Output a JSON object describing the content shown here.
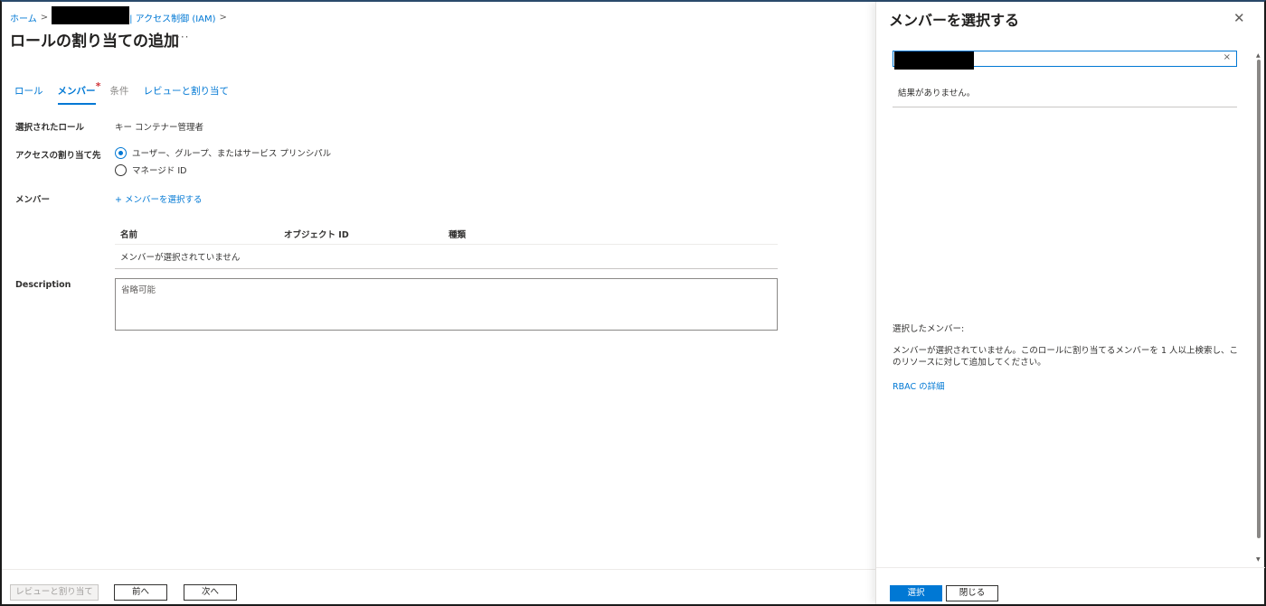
{
  "breadcrumb": {
    "home": "ホーム",
    "sep1": ">",
    "resource_tail": "| アクセス制御 (IAM)",
    "sep2": ">"
  },
  "page": {
    "title": "ロールの割り当ての追加",
    "more": "···"
  },
  "tabs": [
    {
      "label": "ロール",
      "state": "normal"
    },
    {
      "label": "メンバー",
      "state": "active",
      "required_mark": "*"
    },
    {
      "label": "条件",
      "state": "disabled"
    },
    {
      "label": "レビューと割り当て",
      "state": "normal"
    }
  ],
  "form": {
    "selected_role_label": "選択されたロール",
    "selected_role_value": "キー コンテナー管理者",
    "assign_to_label": "アクセスの割り当て先",
    "assign_options": [
      {
        "label": "ユーザー、グループ、またはサービス プリンシパル",
        "checked": true
      },
      {
        "label": "マネージド ID",
        "checked": false
      }
    ],
    "members_label": "メンバー",
    "select_members_link": "+ メンバーを選択する",
    "grid_columns": [
      "名前",
      "オブジェクト ID",
      "種類"
    ],
    "grid_empty": "メンバーが選択されていません",
    "description_label": "Description",
    "description_placeholder": "省略可能"
  },
  "footer": {
    "review_assign": "レビューと割り当て",
    "prev": "前へ",
    "next": "次へ"
  },
  "panel": {
    "title": "メンバーを選択する",
    "close_icon": "close-icon",
    "search_clear": "×",
    "no_results": "結果がありません。",
    "selected_members_label": "選択したメンバー:",
    "selected_members_msg": "メンバーが選択されていません。このロールに割り当てるメンバーを 1 人以上検索し、このリソースに対して追加してください。",
    "rbac_link": "RBAC の詳細",
    "select_button": "選択",
    "close_button": "閉じる"
  },
  "colors": {
    "accent": "#0078d4",
    "required": "#d13438",
    "redaction": "#000000"
  }
}
